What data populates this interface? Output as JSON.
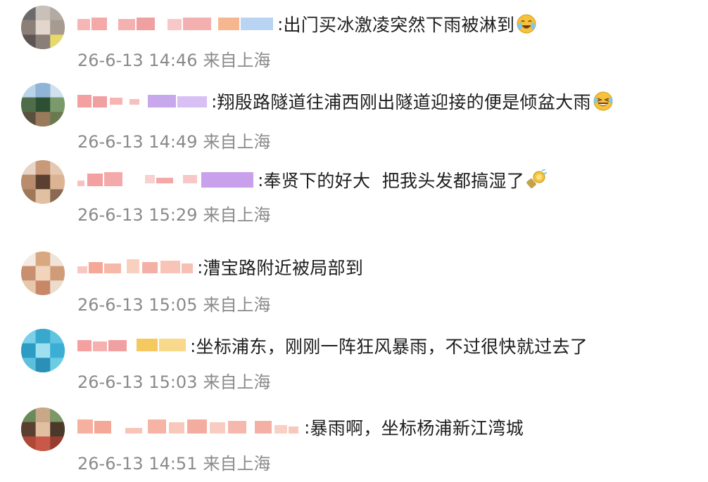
{
  "comments": [
    {
      "username": "",
      "separator": ":",
      "text": "出门买冰激凌突然下雨被淋到",
      "emoji": "crying-laughing-emoji",
      "date": "26-6-13 14:46",
      "location": "来自上海"
    },
    {
      "username": "",
      "separator": ":",
      "text": "翔殷路隧道往浦西刚出隧道迎接的便是倾盆大雨",
      "emoji": "laughing-tears-emoji",
      "date": "26-6-13 14:49",
      "location": "来自上海"
    },
    {
      "username": "",
      "separator": ":",
      "text": "奉贤下的好大  把我头发都搞湿了",
      "emoji": "hair-dryer-emoji",
      "date": "26-6-13 15:29",
      "location": "来自上海"
    },
    {
      "username": "",
      "separator": ":",
      "text": "漕宝路附近被局部到",
      "emoji": "",
      "date": "26-6-13 15:05",
      "location": "来自上海"
    },
    {
      "username": "",
      "separator": ":",
      "text": "坐标浦东，刚刚一阵狂风暴雨，不过很快就过去了",
      "emoji": "",
      "date": "26-6-13 15:03",
      "location": "来自上海"
    },
    {
      "username": "",
      "separator": ":",
      "text": "暴雨啊，坐标杨浦新江湾城",
      "emoji": "",
      "date": "26-6-13 14:51",
      "location": "来自上海"
    }
  ],
  "colors": {
    "text": "#1e1e1e",
    "meta": "#8a8a8a",
    "background": "#ffffff"
  }
}
